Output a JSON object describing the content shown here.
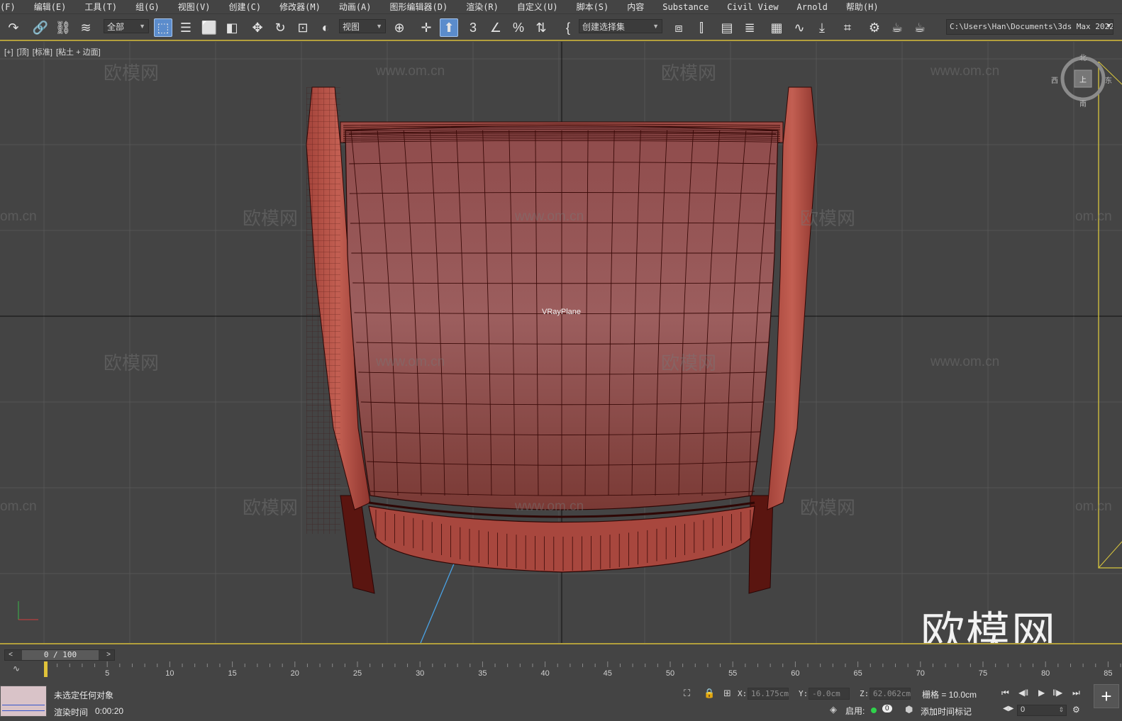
{
  "menu": [
    "(F)",
    "编辑(E)",
    "工具(T)",
    "组(G)",
    "视图(V)",
    "创建(C)",
    "修改器(M)",
    "动画(A)",
    "图形编辑器(D)",
    "渲染(R)",
    "自定义(U)",
    "脚本(S)",
    "内容",
    "Substance",
    "Civil View",
    "Arnold",
    "帮助(H)"
  ],
  "toolbar": {
    "selection_filter": "全部",
    "ref_coord": "视图",
    "named_selection": "创建选择集",
    "project_path": "C:\\Users\\Han\\Documents\\3ds Max 2022",
    "snap_toggle": "3",
    "angle_snap": "∠",
    "percent_snap": "%"
  },
  "viewport": {
    "label": [
      "[+]",
      "[顶]",
      "[标准]",
      "[粘土 + 边面]"
    ],
    "object_label": "VRayPlane",
    "watermark_text": "欧模网",
    "watermark_url": "www.om.cn",
    "watermark_url_partial": "om.cn",
    "big_logo": "欧模网",
    "viewcube": {
      "top": "北",
      "left": "西",
      "right": "东",
      "bottom": "南",
      "face": "上"
    },
    "colors": {
      "model": "#b04a3c",
      "wire": "#3a0a08",
      "background": "#444444",
      "grid": "#555555",
      "axis": "#111111"
    }
  },
  "timeline": {
    "frame_display": "0 / 100",
    "ruler_labels": [
      "0",
      "5",
      "10",
      "15",
      "20",
      "25",
      "30",
      "35",
      "40",
      "45",
      "50",
      "55",
      "60",
      "65",
      "70",
      "75",
      "80",
      "85"
    ]
  },
  "status": {
    "selection": "未选定任何对象",
    "render_time_label": "渲染时间",
    "render_time": "0:00:20",
    "x_label": "X:",
    "x_value": "16.175cm",
    "y_label": "Y:",
    "y_value": "-0.0cm",
    "z_label": "Z:",
    "z_value": "62.062cm",
    "grid": "栅格 = 10.0cm",
    "enable_label": "启用:",
    "enable_count": "0",
    "add_time_tag": "添加时间标记",
    "current_frame": "0"
  }
}
